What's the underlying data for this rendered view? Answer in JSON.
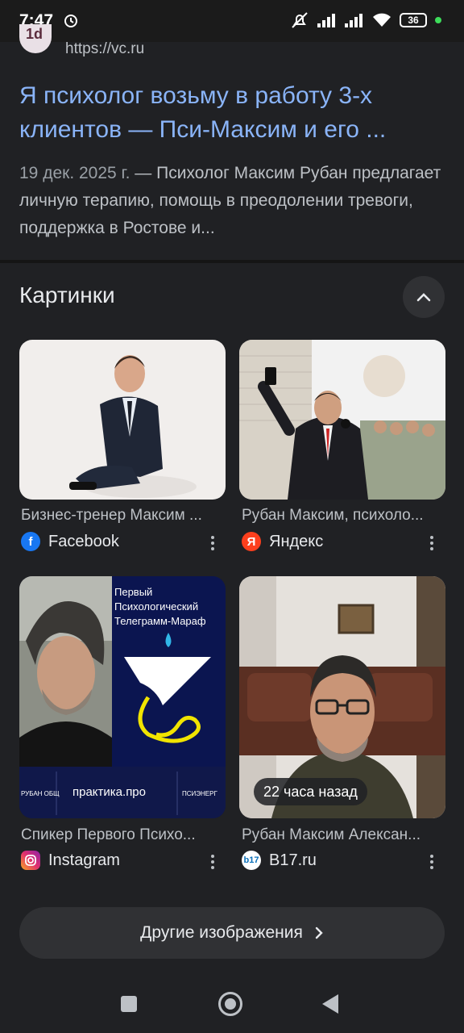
{
  "status": {
    "time": "7:47",
    "battery": "36"
  },
  "result": {
    "url": "https://vc.ru",
    "favicon_text": "1d",
    "title": "Я психолог возьму в работу 3-х клиентов — Пси-Максим и его ...",
    "date": "19 дек. 2025 г.",
    "snippet": " — Психолог Максим Рубан предлагает личную терапию, помощь в преодолении тревоги, поддержка в Ростове и..."
  },
  "images": {
    "title": "Картинки",
    "items": [
      {
        "caption": "Бизнес-тренер Максим ...",
        "source": "Facebook",
        "icon": "facebook-icon",
        "color": "#1877f2"
      },
      {
        "caption": "Рубан Максим, психоло...",
        "source": "Яндекс",
        "icon": "yandex-icon",
        "color": "#fc3f1d"
      },
      {
        "caption": "Спикер Первого Психо...",
        "source": "Instagram",
        "icon": "instagram-icon",
        "color": "#e1306c",
        "overlay": {
          "line1": "Первый",
          "line2": "Психологический",
          "line3": "Телеграмм-Мараф",
          "footer1": "РУБАН ОБЩ",
          "footer2": "практика.про",
          "footer3": "ПСИЭНЕРГ"
        }
      },
      {
        "caption": "Рубан Максим Алексан...",
        "source": "B17.ru",
        "icon": "b17-icon",
        "color": "#ffffff",
        "badge": "22 часа назад"
      }
    ],
    "more_label": "Другие изображения"
  }
}
